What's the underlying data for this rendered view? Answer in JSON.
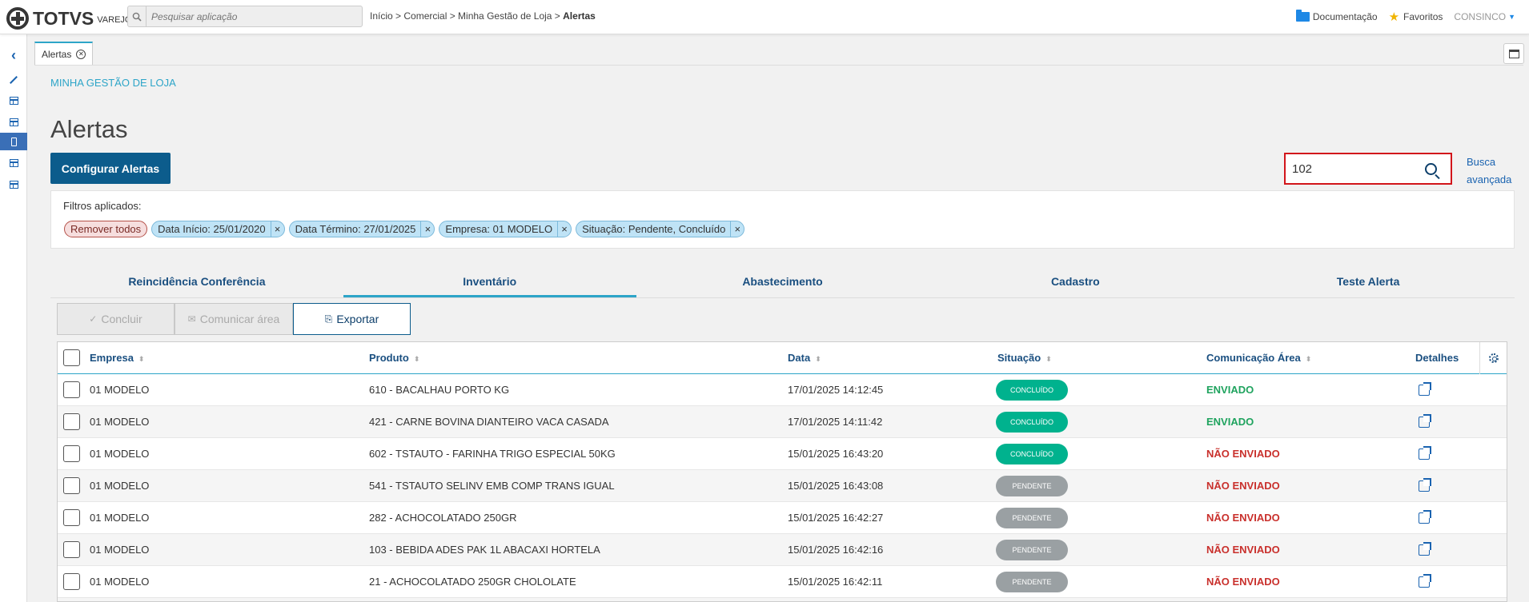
{
  "app": {
    "logo": "TOTVS",
    "logo_sub": "VAREJO"
  },
  "topbar": {
    "search_placeholder": "Pesquisar aplicação",
    "breadcrumb": "Início > Comercial > Minha Gestão de Loja > ",
    "breadcrumb_current": "Alertas",
    "documentation": "Documentação",
    "favorites": "Favoritos",
    "user": "CONSINCO"
  },
  "tab": {
    "label": "Alertas"
  },
  "page": {
    "section": "MINHA GESTÃO DE LOJA",
    "title": "Alertas",
    "config_button": "Configurar Alertas",
    "search_value": "102",
    "advanced_search": "Busca avançada"
  },
  "filters": {
    "label": "Filtros aplicados:",
    "remove_all": "Remover todos",
    "items": [
      "Data Início: 25/01/2020",
      "Data Término: 27/01/2025",
      "Empresa: 01 MODELO",
      "Situação: Pendente, Concluído"
    ]
  },
  "subtabs": [
    "Reincidência Conferência",
    "Inventário",
    "Abastecimento",
    "Cadastro",
    "Teste Alerta"
  ],
  "actions": {
    "conclude": "Concluir",
    "communicate": "Comunicar área",
    "export": "Exportar"
  },
  "table": {
    "headers": {
      "empresa": "Empresa",
      "produto": "Produto",
      "data": "Data",
      "situacao": "Situação",
      "comunicacao": "Comunicação Área",
      "detalhes": "Detalhes"
    },
    "rows": [
      {
        "empresa": "01 MODELO",
        "produto": "610 - BACALHAU PORTO KG",
        "data": "17/01/2025 14:12:45",
        "situacao": "CONCLUÍDO",
        "comunicacao": "ENVIADO"
      },
      {
        "empresa": "01 MODELO",
        "produto": "421 - CARNE BOVINA DIANTEIRO VACA CASADA",
        "data": "17/01/2025 14:11:42",
        "situacao": "CONCLUÍDO",
        "comunicacao": "ENVIADO"
      },
      {
        "empresa": "01 MODELO",
        "produto": "602 - TSTAUTO - FARINHA TRIGO ESPECIAL 50KG",
        "data": "15/01/2025 16:43:20",
        "situacao": "CONCLUÍDO",
        "comunicacao": "NÃO ENVIADO"
      },
      {
        "empresa": "01 MODELO",
        "produto": "541 - TSTAUTO SELINV EMB COMP TRANS IGUAL",
        "data": "15/01/2025 16:43:08",
        "situacao": "PENDENTE",
        "comunicacao": "NÃO ENVIADO"
      },
      {
        "empresa": "01 MODELO",
        "produto": "282 - ACHOCOLATADO 250GR",
        "data": "15/01/2025 16:42:27",
        "situacao": "PENDENTE",
        "comunicacao": "NÃO ENVIADO"
      },
      {
        "empresa": "01 MODELO",
        "produto": "103 - BEBIDA ADES PAK 1L ABACAXI HORTELA",
        "data": "15/01/2025 16:42:16",
        "situacao": "PENDENTE",
        "comunicacao": "NÃO ENVIADO"
      },
      {
        "empresa": "01 MODELO",
        "produto": "21 - ACHOCOLATADO 250GR CHOLOLATE",
        "data": "15/01/2025 16:42:11",
        "situacao": "PENDENTE",
        "comunicacao": "NÃO ENVIADO"
      }
    ]
  },
  "colors": {
    "primary": "#0c5c8c",
    "accent": "#2da5c8",
    "done": "#00b28e",
    "pending": "#9aa0a3",
    "sent": "#1fa35e",
    "not_sent": "#c9302c",
    "highlight": "#d2151b"
  }
}
